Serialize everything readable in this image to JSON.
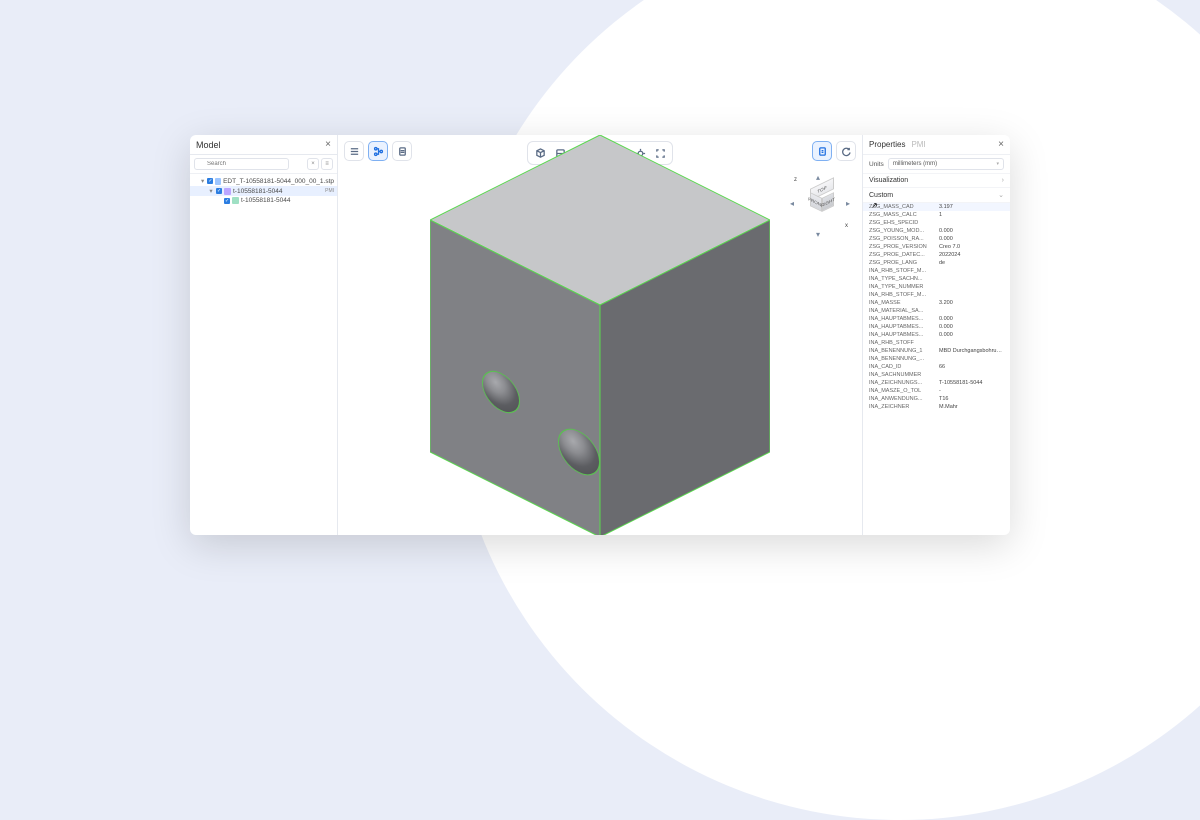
{
  "model_panel": {
    "title": "Model",
    "search_placeholder": "Search",
    "tree": [
      {
        "label": "EDT_T-10558181-5044_000_00_1.stp",
        "indent": 1,
        "icon": "stp",
        "caret": "▾"
      },
      {
        "label": "t-10558181-5044",
        "indent": 2,
        "icon": "asm",
        "caret": "▾",
        "pmi": "PMI",
        "selected": true
      },
      {
        "label": "t-10558181-5044",
        "indent": 3,
        "icon": "part",
        "caret": ""
      }
    ]
  },
  "toolbar": {
    "left": [
      "menu",
      "tree",
      "document"
    ],
    "center": [
      "cube",
      "clip",
      "wire",
      "shade",
      "views",
      "focus",
      "fit"
    ],
    "right": [
      "sheet",
      "refresh"
    ],
    "active_left": "tree",
    "active_center": "shade",
    "active_right": "sheet"
  },
  "navcube": {
    "top": "TOP",
    "front": "FRONT",
    "right": "RIGHT",
    "axis_x": "x",
    "axis_z": "z"
  },
  "properties": {
    "title": "Properties",
    "tab_inactive": "PMI",
    "units_label": "Units",
    "units_value": "millimeters (mm)",
    "vis_label": "Visualization",
    "custom_label": "Custom",
    "rows": [
      {
        "k": "ZSG_MASS_CAD",
        "v": "3.197",
        "hover": true
      },
      {
        "k": "ZSG_MASS_CALC",
        "v": "1"
      },
      {
        "k": "ZSG_EHS_SPECID",
        "v": ""
      },
      {
        "k": "ZSG_YOUNG_MOD...",
        "v": "0.000"
      },
      {
        "k": "ZSG_POISSON_RA...",
        "v": "0.000"
      },
      {
        "k": "ZSG_PROE_VERSION",
        "v": "Creo 7.0"
      },
      {
        "k": "ZSG_PROE_DATEC...",
        "v": "2022024"
      },
      {
        "k": "ZSG_PROE_LANG",
        "v": "de"
      },
      {
        "k": "INA_RHB_STOFF_M...",
        "v": ""
      },
      {
        "k": "INA_TYPE_SACHN...",
        "v": ""
      },
      {
        "k": "INA_TYPE_NUMMER",
        "v": ""
      },
      {
        "k": "INA_RHB_STOFF_M...",
        "v": ""
      },
      {
        "k": "INA_MASSE",
        "v": "3.200"
      },
      {
        "k": "INA_MATERIAL_SA...",
        "v": ""
      },
      {
        "k": "INA_HAUPTABMES...",
        "v": "0.000"
      },
      {
        "k": "INA_HAUPTABMES...",
        "v": "0.000"
      },
      {
        "k": "INA_HAUPTABMES...",
        "v": "0.000"
      },
      {
        "k": "INA_RHB_STOFF",
        "v": ""
      },
      {
        "k": "INA_BENENNUNG_1",
        "v": "MBD Durchgangsbohrung mit Gewi..."
      },
      {
        "k": "INA_BENENNUNG_...",
        "v": ""
      },
      {
        "k": "INA_CAD_ID",
        "v": "66"
      },
      {
        "k": "INA_SACHNUMMER",
        "v": ""
      },
      {
        "k": "INA_ZEICHNUNGS...",
        "v": "T-10558181-5044"
      },
      {
        "k": "INA_MASZE_O_TOL",
        "v": "-"
      },
      {
        "k": "INA_ANWENDUNG...",
        "v": "T16"
      },
      {
        "k": "INA_ZEICHNER",
        "v": "M.Mahr"
      }
    ]
  }
}
